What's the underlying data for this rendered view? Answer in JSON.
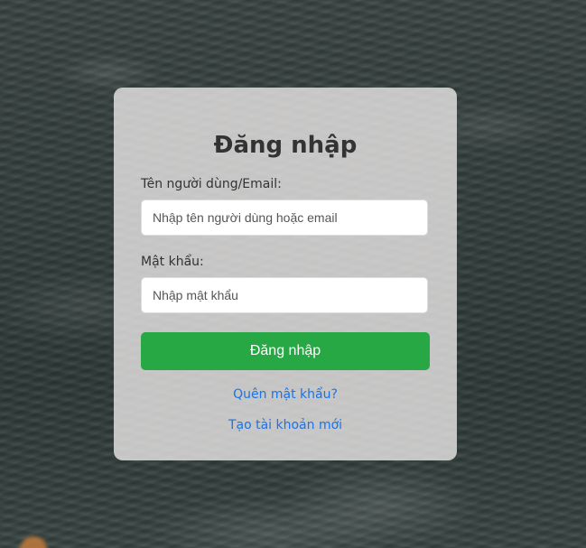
{
  "login": {
    "title": "Đăng nhập",
    "username_label": "Tên người dùng/Email:",
    "username_placeholder": "Nhập tên người dùng hoặc email",
    "password_label": "Mật khẩu:",
    "password_placeholder": "Nhập mật khẩu",
    "submit_label": "Đăng nhập",
    "forgot_password_link": "Quên mật khẩu?",
    "create_account_link": "Tạo tài khoản mới"
  },
  "colors": {
    "button": "#28a745",
    "link": "#1a73e8",
    "card_background": "rgba(236,232,232,0.80)"
  }
}
